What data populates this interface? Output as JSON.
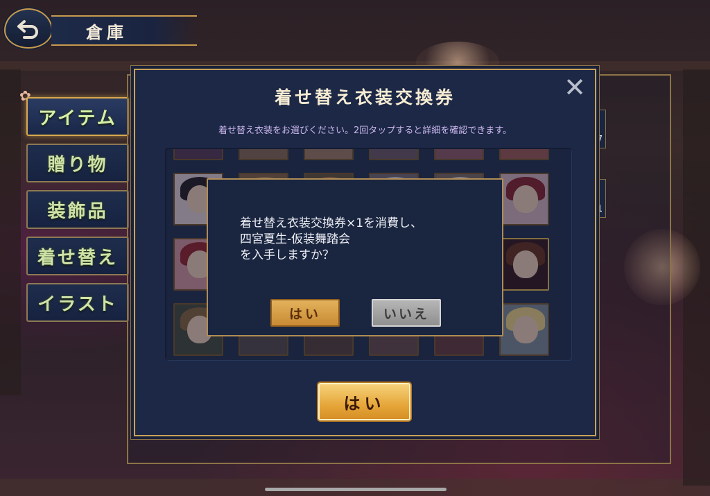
{
  "header": {
    "title": "倉庫"
  },
  "nav": {
    "items": [
      {
        "label": "アイテム",
        "active": true
      },
      {
        "label": "贈り物",
        "active": false
      },
      {
        "label": "装飾品",
        "active": false
      },
      {
        "label": "着せ替え",
        "active": false
      },
      {
        "label": "イラスト",
        "active": false
      }
    ]
  },
  "background_counts": [
    "7",
    "1"
  ],
  "modal": {
    "title": "着せ替え衣装交換券",
    "subtitle": "着せ替え衣装をお選びください。2回タップすると詳細を確認できます。",
    "close_label": "✕",
    "ok_label": "はい"
  },
  "confirm": {
    "lines": [
      "着せ替え衣装交換券×1を消費し、",
      "四宮夏生-仮装舞踏会",
      "を入手しますか？"
    ],
    "yes_label": "はい",
    "no_label": "いいえ"
  },
  "colors": {
    "panel": "#1c2846",
    "gold_border": "#c9a25a",
    "nav_text": "#cfe2a8",
    "subtitle": "#cbb7ec"
  }
}
